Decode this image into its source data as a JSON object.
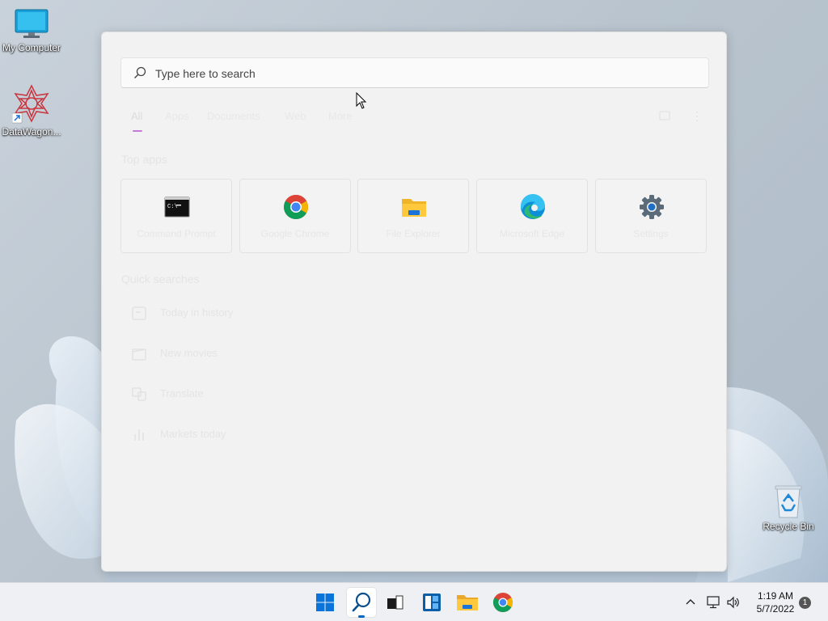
{
  "desktop": {
    "icons": [
      {
        "label": "My Computer",
        "icon": "monitor-icon"
      },
      {
        "label": "DataWagon...",
        "icon": "datawagon-icon"
      },
      {
        "label": "Recycle Bin",
        "icon": "recycle-bin-icon"
      }
    ]
  },
  "search_panel": {
    "search": {
      "placeholder": "Type here to search",
      "value": ""
    },
    "tabs": [
      "All",
      "Apps",
      "Documents",
      "Web",
      "More"
    ],
    "active_tab": "All",
    "top_apps_title": "Top apps",
    "top_apps": [
      {
        "label": "Command Prompt",
        "icon": "command-prompt-icon"
      },
      {
        "label": "Google Chrome",
        "icon": "chrome-icon"
      },
      {
        "label": "File Explorer",
        "icon": "file-explorer-icon"
      },
      {
        "label": "Microsoft Edge",
        "icon": "edge-icon"
      },
      {
        "label": "Settings",
        "icon": "settings-gear-icon"
      }
    ],
    "quick_searches_title": "Quick searches",
    "quick_searches": [
      {
        "label": "Today in history",
        "icon": "calendar-icon"
      },
      {
        "label": "New movies",
        "icon": "movie-icon"
      },
      {
        "label": "Translate",
        "icon": "translate-icon"
      },
      {
        "label": "Markets today",
        "icon": "chart-icon"
      }
    ]
  },
  "taskbar": {
    "items": [
      {
        "name": "start",
        "icon": "windows-logo-icon"
      },
      {
        "name": "search",
        "icon": "search-icon",
        "active": true
      },
      {
        "name": "task-view",
        "icon": "task-view-icon"
      },
      {
        "name": "widgets",
        "icon": "widgets-icon"
      },
      {
        "name": "file-explorer",
        "icon": "folder-icon"
      },
      {
        "name": "chrome",
        "icon": "chrome-icon"
      }
    ],
    "clock": {
      "time": "1:19 AM",
      "date": "5/7/2022"
    },
    "notification_count": "1"
  },
  "colors": {
    "accent": "#0067c0",
    "tab_underline": "#c57ad6",
    "panel_bg": "#f2f2f2"
  }
}
